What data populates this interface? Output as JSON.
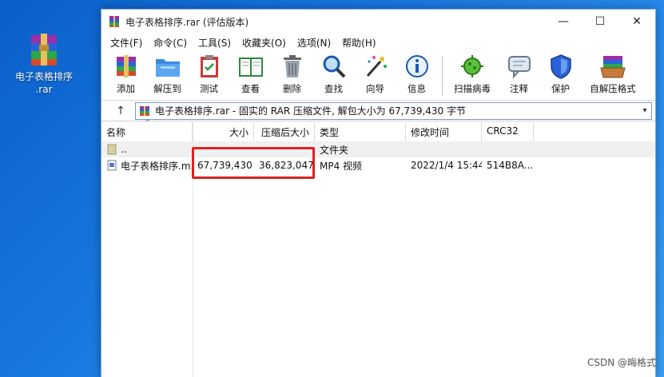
{
  "desktop": {
    "icon_label_line1": "电子表格排序",
    "icon_label_line2": ".rar"
  },
  "window": {
    "title": "电子表格排序.rar (评估版本)",
    "controls": {
      "minimize": "—",
      "maximize": "☐",
      "close": "✕"
    }
  },
  "menu": [
    "文件(F)",
    "命令(C)",
    "工具(S)",
    "收藏夹(O)",
    "选项(N)",
    "帮助(H)"
  ],
  "toolbar": [
    {
      "label": "添加",
      "icon": "add-archive-icon"
    },
    {
      "label": "解压到",
      "icon": "extract-folder-icon"
    },
    {
      "label": "测试",
      "icon": "test-clipboard-icon"
    },
    {
      "label": "查看",
      "icon": "view-book-icon"
    },
    {
      "label": "删除",
      "icon": "trash-icon"
    },
    {
      "label": "查找",
      "icon": "magnifier-icon"
    },
    {
      "label": "向导",
      "icon": "wizard-wand-icon"
    },
    {
      "label": "信息",
      "icon": "info-icon"
    },
    {
      "label": "扫描病毒",
      "icon": "virus-scan-icon"
    },
    {
      "label": "注释",
      "icon": "comment-icon"
    },
    {
      "label": "保护",
      "icon": "shield-icon"
    },
    {
      "label": "自解压格式",
      "icon": "sfx-box-icon"
    }
  ],
  "address": {
    "up": "↑",
    "text": "电子表格排序.rar - 固实的 RAR 压缩文件, 解包大小为 67,739,430 字节"
  },
  "columns": {
    "name": "名称",
    "size": "大小",
    "packed": "压缩后大小",
    "type": "类型",
    "modified": "修改时间",
    "crc": "CRC32"
  },
  "rows": [
    {
      "name": "..",
      "size": "",
      "packed": "",
      "type": "文件夹",
      "modified": "",
      "crc": ""
    },
    {
      "name": "电子表格排序.m...",
      "size": "67,739,430",
      "packed": "36,823,047",
      "type": "MP4 视频",
      "modified": "2022/1/4 15:44",
      "crc": "514B8A..."
    }
  ],
  "watermark": "CSDN @晦格式",
  "colors": {
    "highlight": "#e02020",
    "desktop": "#1879e0"
  }
}
